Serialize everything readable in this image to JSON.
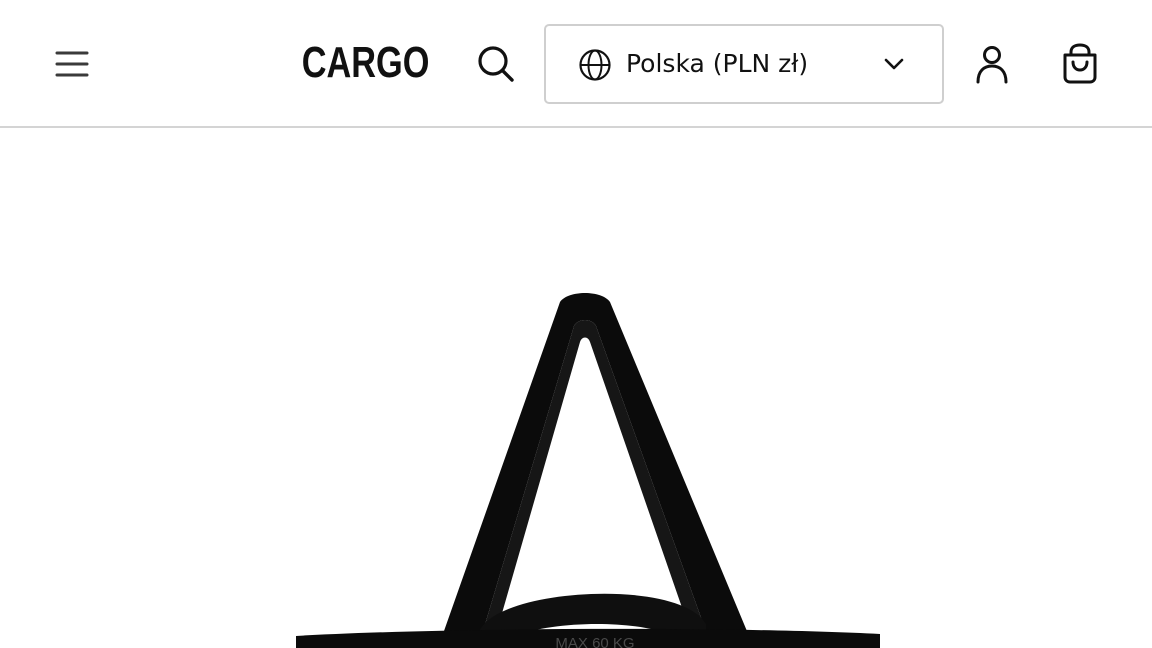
{
  "header": {
    "menu_icon": "hamburger-menu-icon",
    "logo_text": "CARGO",
    "search_icon": "search-icon",
    "locale": {
      "icon": "globe-icon",
      "label": "Polska (PLN zł)",
      "chevron_icon": "chevron-down-icon"
    },
    "account_icon": "user-icon",
    "cart_icon": "shopping-bag-icon"
  },
  "product": {
    "image_description": "black tote bag with shoulder straps",
    "bag_imprint": "MAX 60 KG"
  },
  "colors": {
    "background": "#ffffff",
    "text": "#111111",
    "border": "#cfcfcf",
    "header_divider": "#d4d4d4",
    "product": "#0b0b0b"
  }
}
